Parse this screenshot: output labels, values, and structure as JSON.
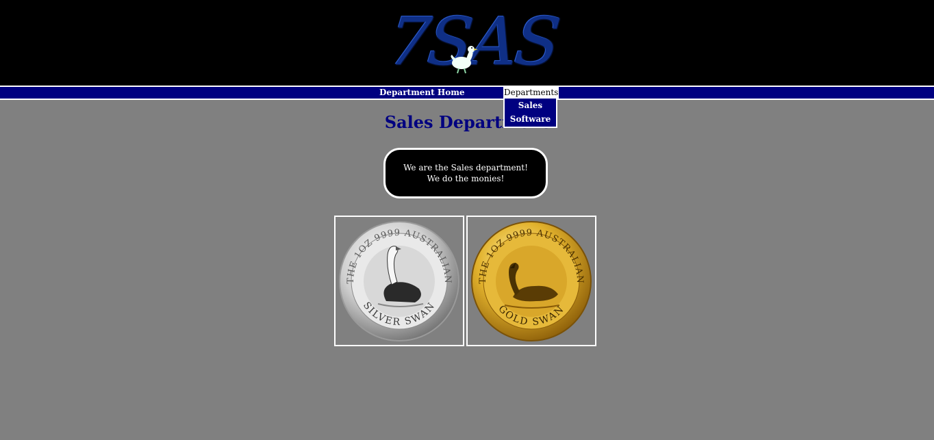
{
  "header": {
    "logo_text": "7SAS",
    "logo_icon": "duck-icon"
  },
  "nav": {
    "home_label": "Department Home",
    "departments_label": "Departments",
    "dropdown_items": [
      {
        "label": "Sales"
      },
      {
        "label": "Software"
      }
    ]
  },
  "main": {
    "title": "Sales Department",
    "message_line1": "We are the Sales department!",
    "message_line2": "We do the monies!"
  },
  "coins": [
    {
      "name": "silver-swan",
      "top_text": "THE 1OZ 9999 AUSTRALIAN",
      "bottom_text": "SILVER SWAN",
      "color": "#c8c8c8"
    },
    {
      "name": "gold-swan",
      "top_text": "THE 1OZ 9999 AUSTRALIAN",
      "bottom_text": "GOLD SWAN",
      "color": "#d4a017"
    }
  ],
  "colors": {
    "background": "#808080",
    "header_bg": "#000000",
    "nav_bg": "#000080",
    "title_color": "#000080",
    "logo_color": "#0f2f86"
  }
}
